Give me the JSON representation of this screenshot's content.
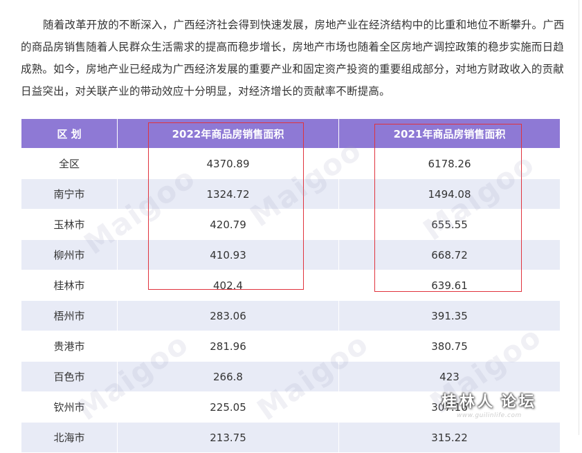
{
  "intro_text": "随着改革开放的不断深入，广西经济社会得到快速发展，房地产业在经济结构中的比重和地位不断攀升。广西的商品房销售随着人民群众生活需求的提高而稳步增长，房地产市场也随着全区房地产调控政策的稳步实施而日趋成熟。如今，房地产业已经成为广西经济发展的重要产业和固定资产投资的重要组成部分，对地方财政收入的贡献日益突出，对关联产业的带动效应十分明显，对经济增长的贡献率不断提高。",
  "table": {
    "headers": [
      "区 划",
      "2022年商品房销售面积",
      "2021年商品房销售面积"
    ],
    "rows": [
      {
        "region": "全区",
        "y2022": "4370.89",
        "y2021": "6178.26"
      },
      {
        "region": "南宁市",
        "y2022": "1324.72",
        "y2021": "1494.08"
      },
      {
        "region": "玉林市",
        "y2022": "420.79",
        "y2021": "655.55"
      },
      {
        "region": "柳州市",
        "y2022": "410.93",
        "y2021": "668.72"
      },
      {
        "region": "桂林市",
        "y2022": "402.4",
        "y2021": "639.61"
      },
      {
        "region": "梧州市",
        "y2022": "283.06",
        "y2021": "391.35"
      },
      {
        "region": "贵港市",
        "y2022": "281.96",
        "y2021": "380.75"
      },
      {
        "region": "百色市",
        "y2022": "266.8",
        "y2021": "423"
      },
      {
        "region": "钦州市",
        "y2022": "225.05",
        "y2021": "307.16"
      },
      {
        "region": "北海市",
        "y2022": "213.75",
        "y2021": "315.22"
      }
    ]
  },
  "watermark_text": "Maigoo",
  "forum_logo": {
    "name": "桂林人",
    "suffix": "论坛",
    "url": "www.guilinlife.com"
  },
  "colors": {
    "header_bg": "#8e79d5",
    "stripe_bg": "#e8ebf6",
    "highlight": "#e0323c"
  }
}
